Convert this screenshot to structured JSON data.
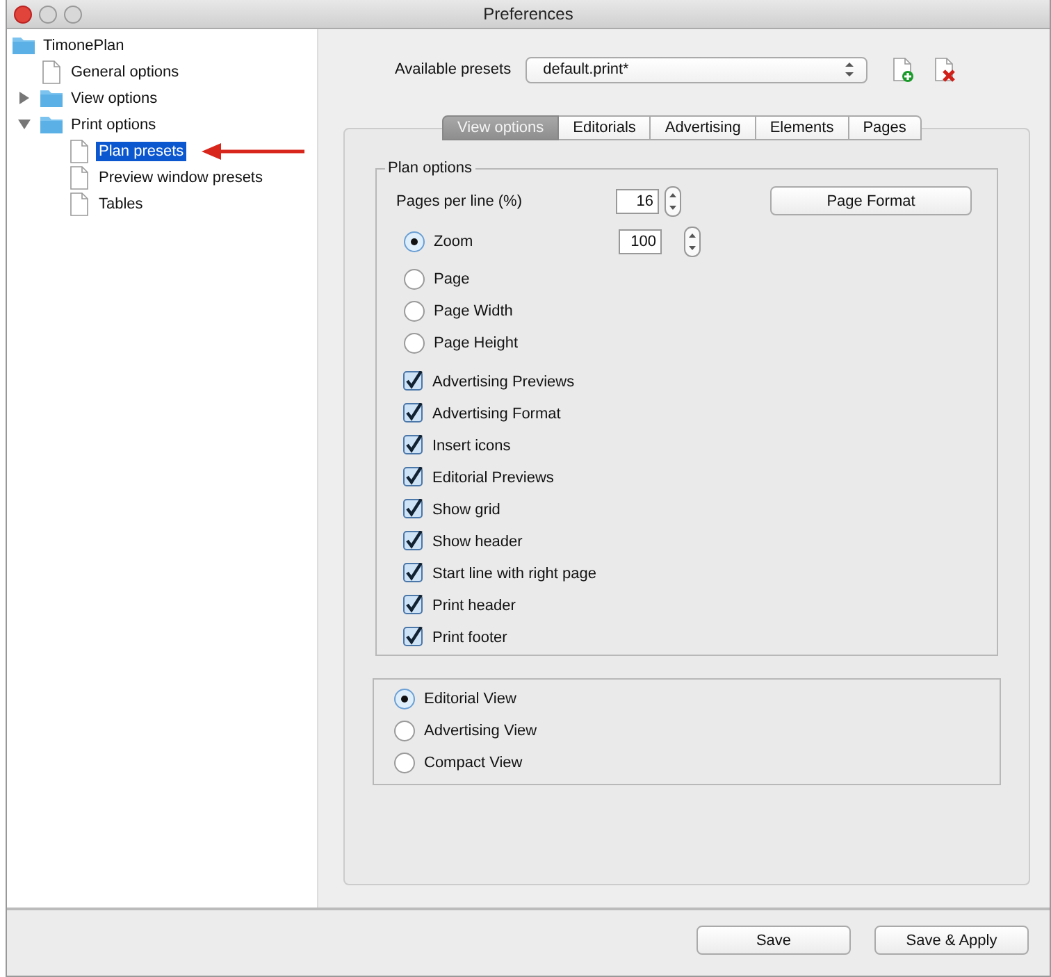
{
  "window": {
    "title": "Preferences"
  },
  "tree": [
    {
      "label": "TimonePlan",
      "kind": "folder",
      "selected": false,
      "children": [
        {
          "label": "General options",
          "kind": "file",
          "selected": false
        },
        {
          "label": "View options",
          "kind": "folder",
          "selected": false,
          "expanded": false
        },
        {
          "label": "Print options",
          "kind": "folder",
          "selected": false,
          "expanded": true,
          "children": [
            {
              "label": "Plan presets",
              "kind": "file",
              "selected": true
            },
            {
              "label": "Preview window presets",
              "kind": "file",
              "selected": false
            },
            {
              "label": "Tables",
              "kind": "file",
              "selected": false
            }
          ]
        }
      ]
    }
  ],
  "presets": {
    "label": "Available presets",
    "value": "default.print*"
  },
  "tabs": [
    {
      "label": "View options",
      "selected": true
    },
    {
      "label": "Editorials",
      "selected": false
    },
    {
      "label": "Advertising",
      "selected": false
    },
    {
      "label": "Elements",
      "selected": false
    },
    {
      "label": "Pages",
      "selected": false
    }
  ],
  "plan_options": {
    "title": "Plan options",
    "pages_per_line": {
      "label": "Pages per line (%)",
      "value": "16"
    },
    "page_format_button": "Page Format",
    "zoom_modes": [
      {
        "label": "Zoom",
        "selected": true,
        "value": "100"
      },
      {
        "label": "Page",
        "selected": false
      },
      {
        "label": "Page Width",
        "selected": false
      },
      {
        "label": "Page Height",
        "selected": false
      }
    ],
    "checkboxes": [
      {
        "label": "Advertising Previews",
        "checked": true
      },
      {
        "label": "Advertising Format",
        "checked": true
      },
      {
        "label": "Insert icons",
        "checked": true
      },
      {
        "label": "Editorial Previews",
        "checked": true
      },
      {
        "label": "Show grid",
        "checked": true
      },
      {
        "label": "Show header",
        "checked": true
      },
      {
        "label": "Start line with right page",
        "checked": true
      },
      {
        "label": "Print header",
        "checked": true
      },
      {
        "label": "Print footer",
        "checked": true
      }
    ]
  },
  "view_modes": [
    {
      "label": "Editorial View",
      "selected": true
    },
    {
      "label": "Advertising View",
      "selected": false
    },
    {
      "label": "Compact View",
      "selected": false
    }
  ],
  "buttons": [
    "Save",
    "Save & Apply"
  ]
}
